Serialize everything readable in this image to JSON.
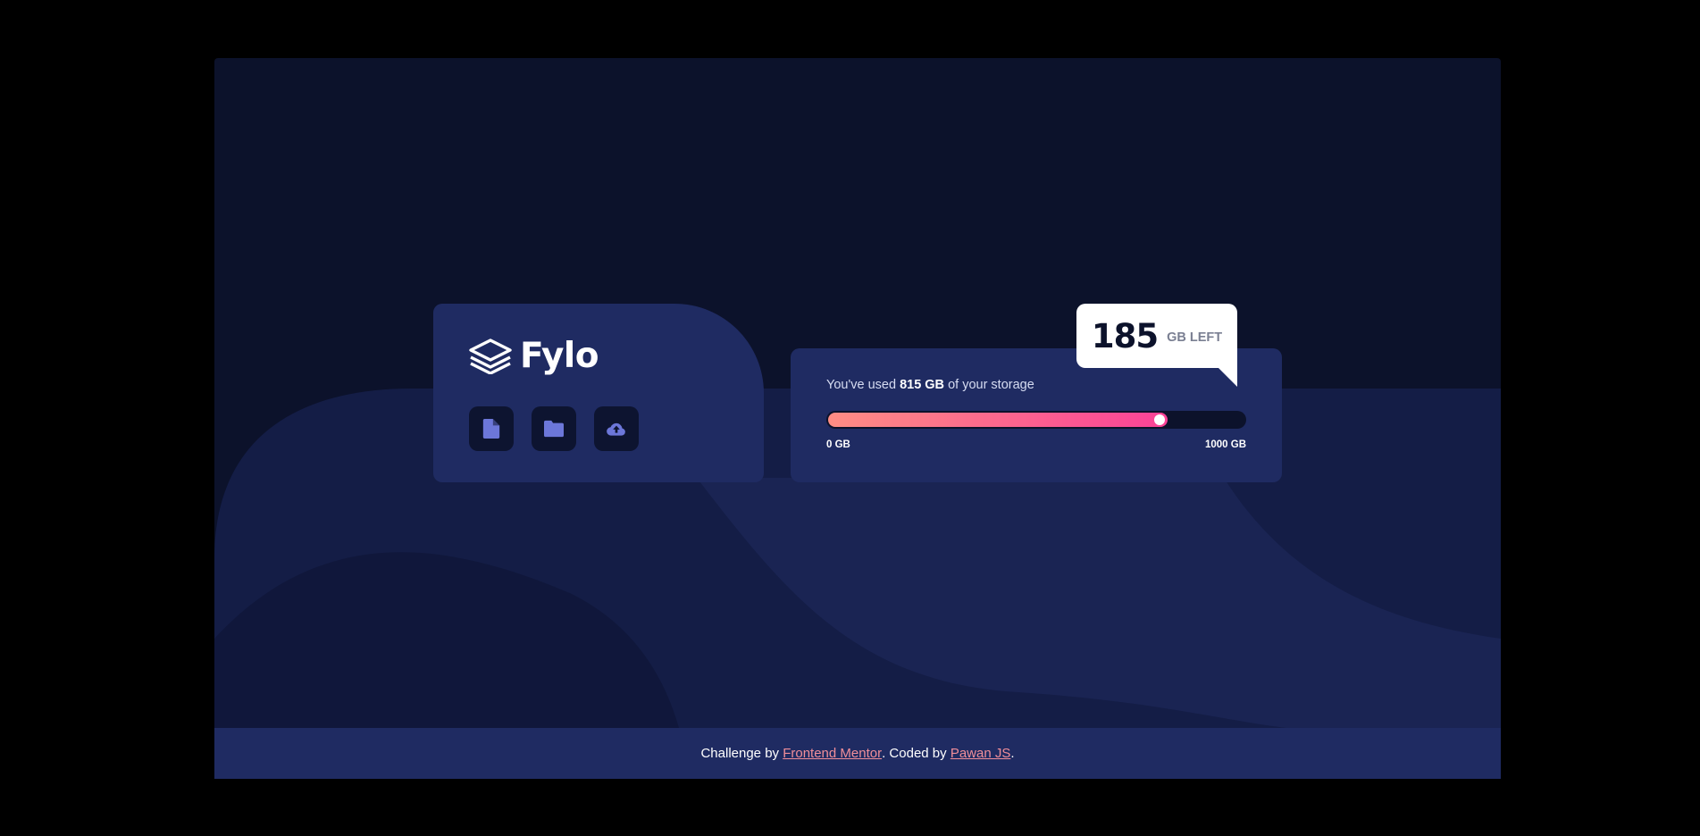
{
  "brand": {
    "name": "Fylo",
    "logo_icon": "stacked-layers-icon"
  },
  "actions": [
    {
      "name": "document-button",
      "icon": "document-icon"
    },
    {
      "name": "folder-button",
      "icon": "folder-icon"
    },
    {
      "name": "upload-button",
      "icon": "cloud-upload-icon"
    }
  ],
  "storage": {
    "usage_prefix": "You've used",
    "used_amount": "815 GB",
    "usage_suffix": "of your storage",
    "used_fraction": 0.815,
    "scale_min": "0 GB",
    "scale_max": "1000 GB",
    "remaining_number": "185",
    "remaining_unit": "GB LEFT"
  },
  "footer": {
    "prefix": "Challenge by",
    "link1": "Frontend Mentor",
    "middle": ". Coded by",
    "link2": "Pawan JS",
    "suffix": "."
  },
  "colors": {
    "background": "#0c122b",
    "card": "#1f2b62",
    "gradient_start": "#fe8d84",
    "gradient_end": "#fa4297",
    "link": "#f08e99"
  }
}
